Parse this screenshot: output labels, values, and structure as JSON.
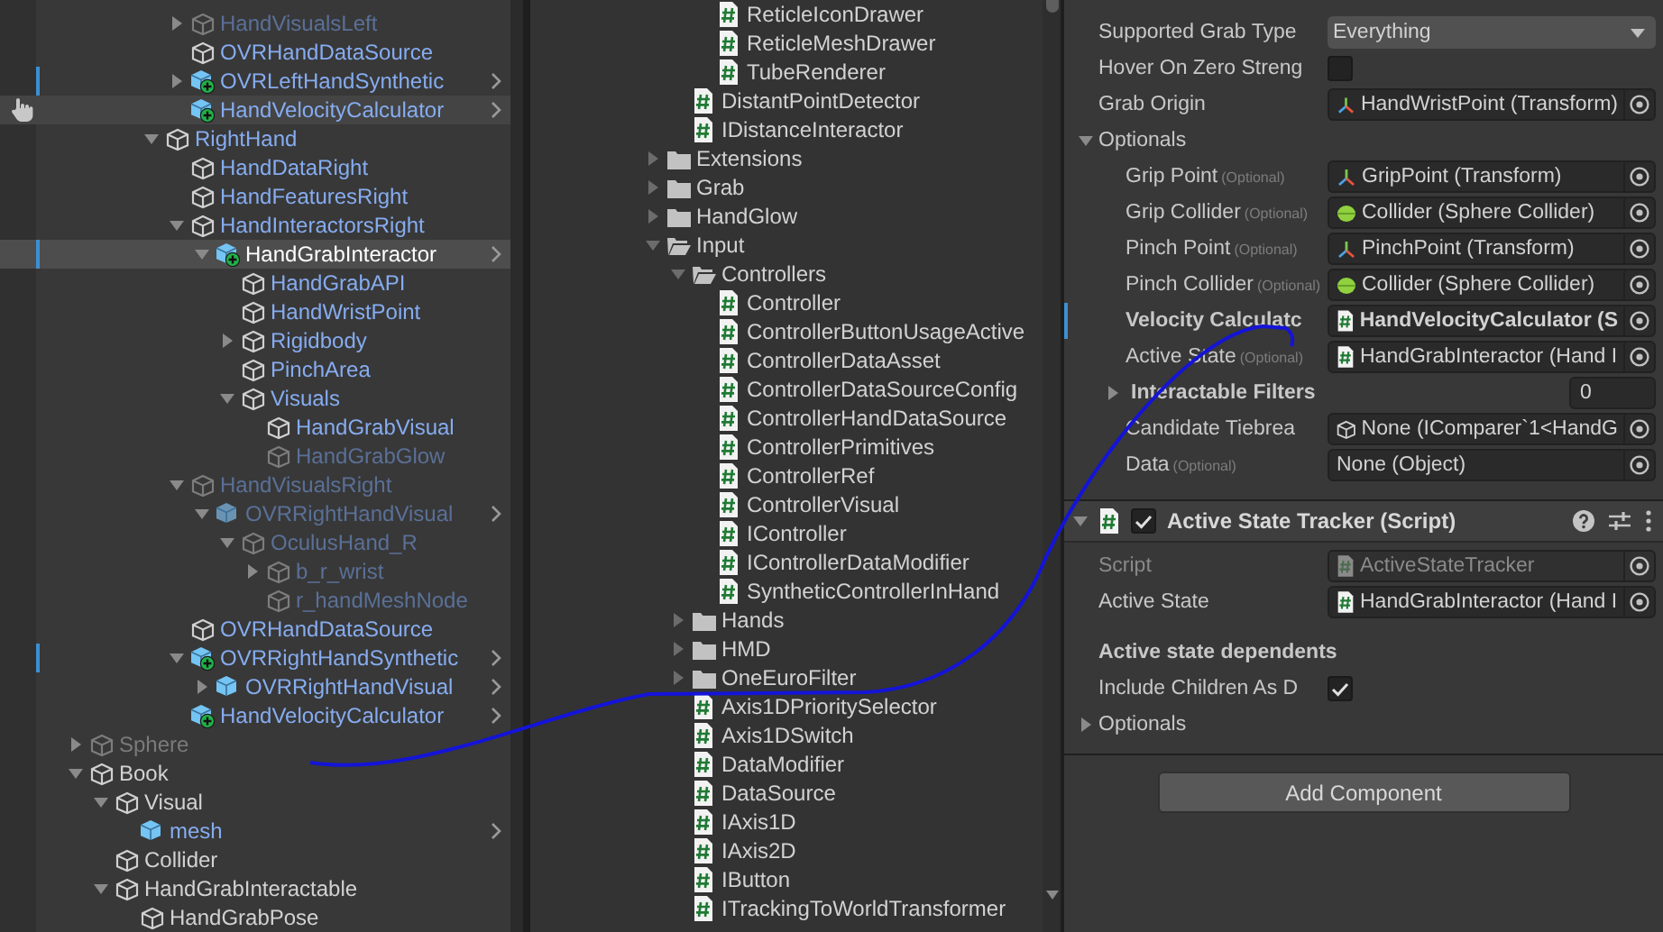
{
  "hierarchy": {
    "items": [
      {
        "children": [
          {
            "children": [
              {
                "children": [
                  {
                    "children": [
                      {
                        "label": "HandVisualsLeft",
                        "kind": "cube",
                        "prefab": true,
                        "active": false,
                        "expanded": false,
                        "selected": false
                      },
                      {
                        "label": "OVRHandDataSource",
                        "kind": "cube",
                        "prefab": true,
                        "active": true,
                        "selected": false
                      },
                      {
                        "label": "OVRLeftHandSynthetic",
                        "kind": "prefab_added",
                        "prefab": true,
                        "active": true,
                        "expanded": false,
                        "open_prefab": true,
                        "modified": true,
                        "selected": false
                      },
                      {
                        "label": "HandVelocityCalculator",
                        "kind": "prefab_added",
                        "prefab": true,
                        "active": true,
                        "open_prefab": true,
                        "hovered": true,
                        "selected": false
                      }
                    ]
                  },
                  {
                    "label": "RightHand",
                    "kind": "cube",
                    "prefab": true,
                    "active": true,
                    "expanded": true,
                    "selected": false,
                    "children": [
                      {
                        "label": "HandDataRight",
                        "kind": "cube",
                        "prefab": true,
                        "active": true,
                        "selected": false
                      },
                      {
                        "label": "HandFeaturesRight",
                        "kind": "cube",
                        "prefab": true,
                        "active": true,
                        "selected": false
                      },
                      {
                        "label": "HandInteractorsRight",
                        "kind": "cube",
                        "prefab": true,
                        "active": true,
                        "expanded": true,
                        "selected": false,
                        "children": [
                          {
                            "label": "HandGrabInteractor",
                            "kind": "prefab_added",
                            "active": true,
                            "expanded": true,
                            "open_prefab": true,
                            "modified": true,
                            "selected": true,
                            "children": [
                              {
                                "label": "HandGrabAPI",
                                "kind": "cube",
                                "prefab": true,
                                "active": true,
                                "selected": false
                              },
                              {
                                "label": "HandWristPoint",
                                "kind": "cube",
                                "prefab": true,
                                "active": true,
                                "selected": false
                              },
                              {
                                "label": "Rigidbody",
                                "kind": "cube",
                                "prefab": true,
                                "active": true,
                                "expanded": false,
                                "selected": false
                              },
                              {
                                "label": "PinchArea",
                                "kind": "cube",
                                "prefab": true,
                                "active": true,
                                "selected": false
                              },
                              {
                                "label": "Visuals",
                                "kind": "cube",
                                "prefab": true,
                                "active": true,
                                "expanded": true,
                                "selected": false,
                                "children": [
                                  {
                                    "label": "HandGrabVisual",
                                    "kind": "cube",
                                    "prefab": true,
                                    "active": true,
                                    "selected": false
                                  },
                                  {
                                    "label": "HandGrabGlow",
                                    "kind": "cube",
                                    "prefab": true,
                                    "active": false,
                                    "selected": false
                                  }
                                ]
                              }
                            ]
                          }
                        ]
                      },
                      {
                        "label": "HandVisualsRight",
                        "kind": "cube",
                        "prefab": true,
                        "active": false,
                        "expanded": true,
                        "selected": false,
                        "children": [
                          {
                            "label": "OVRRightHandVisual",
                            "kind": "prefab",
                            "prefab": true,
                            "active": false,
                            "expanded": true,
                            "open_prefab": true,
                            "selected": false,
                            "children": [
                              {
                                "label": "OculusHand_R",
                                "kind": "cube",
                                "prefab": true,
                                "active": false,
                                "expanded": true,
                                "selected": false,
                                "children": [
                                  {
                                    "label": "b_r_wrist",
                                    "kind": "cube",
                                    "prefab": true,
                                    "active": false,
                                    "expanded": false,
                                    "selected": false
                                  },
                                  {
                                    "label": "r_handMeshNode",
                                    "kind": "cube",
                                    "prefab": true,
                                    "active": false,
                                    "selected": false
                                  }
                                ]
                              }
                            ]
                          }
                        ]
                      },
                      {
                        "label": "OVRHandDataSource",
                        "kind": "cube",
                        "prefab": true,
                        "active": true,
                        "selected": false
                      },
                      {
                        "label": "OVRRightHandSynthetic",
                        "kind": "prefab_added",
                        "prefab": true,
                        "active": true,
                        "expanded": true,
                        "open_prefab": true,
                        "modified": true,
                        "selected": false,
                        "children": [
                          {
                            "label": "OVRRightHandVisual",
                            "kind": "prefab",
                            "prefab": true,
                            "active": true,
                            "expanded": false,
                            "open_prefab": true,
                            "selected": false
                          }
                        ]
                      },
                      {
                        "label": "HandVelocityCalculator",
                        "kind": "prefab_added",
                        "prefab": true,
                        "active": true,
                        "open_prefab": true,
                        "selected": false
                      }
                    ]
                  }
                ]
              }
            ]
          }
        ]
      },
      {
        "label": "Sphere",
        "kind": "cube",
        "prefab": false,
        "active": false,
        "expanded": false,
        "selected": false
      },
      {
        "label": "Book",
        "kind": "cube",
        "prefab": false,
        "active": true,
        "expanded": true,
        "selected": false,
        "children": [
          {
            "label": "Visual",
            "kind": "cube",
            "prefab": false,
            "active": true,
            "expanded": true,
            "selected": false,
            "children": [
              {
                "label": "mesh",
                "kind": "prefab",
                "prefab": true,
                "active": true,
                "open_prefab": true,
                "selected": false
              }
            ]
          },
          {
            "label": "Collider",
            "kind": "cube",
            "prefab": false,
            "active": true,
            "selected": false
          },
          {
            "label": "HandGrabInteractable",
            "kind": "cube",
            "prefab": false,
            "active": true,
            "expanded": true,
            "selected": false,
            "children": [
              {
                "label": "HandGrabPose",
                "kind": "cube",
                "prefab": false,
                "active": true,
                "selected": false
              }
            ]
          }
        ]
      }
    ]
  },
  "project": {
    "items": [
      {
        "children": [
          {
            "children": [
              {
                "label": "ReticleIconDrawer",
                "kind": "script"
              },
              {
                "label": "ReticleMeshDrawer",
                "kind": "script"
              },
              {
                "label": "TubeRenderer",
                "kind": "script"
              }
            ]
          },
          {
            "label": "DistantPointDetector",
            "kind": "script"
          },
          {
            "label": "IDistanceInteractor",
            "kind": "script"
          }
        ]
      },
      {
        "label": "Extensions",
        "kind": "folder",
        "expanded": false
      },
      {
        "label": "Grab",
        "kind": "folder",
        "expanded": false
      },
      {
        "label": "HandGlow",
        "kind": "folder",
        "expanded": false
      },
      {
        "label": "Input",
        "kind": "folder",
        "expanded": true,
        "children": [
          {
            "label": "Controllers",
            "kind": "folder",
            "expanded": true,
            "children": [
              {
                "label": "Controller",
                "kind": "script"
              },
              {
                "label": "ControllerButtonUsageActive",
                "kind": "script"
              },
              {
                "label": "ControllerDataAsset",
                "kind": "script"
              },
              {
                "label": "ControllerDataSourceConfig",
                "kind": "script"
              },
              {
                "label": "ControllerHandDataSource",
                "kind": "script"
              },
              {
                "label": "ControllerPrimitives",
                "kind": "script"
              },
              {
                "label": "ControllerRef",
                "kind": "script"
              },
              {
                "label": "ControllerVisual",
                "kind": "script"
              },
              {
                "label": "IController",
                "kind": "script"
              },
              {
                "label": "IControllerDataModifier",
                "kind": "script"
              },
              {
                "label": "SyntheticControllerInHand",
                "kind": "script"
              }
            ]
          },
          {
            "label": "Hands",
            "kind": "folder",
            "expanded": false
          },
          {
            "label": "HMD",
            "kind": "folder",
            "expanded": false
          },
          {
            "label": "OneEuroFilter",
            "kind": "folder",
            "expanded": false
          },
          {
            "label": "Axis1DPrioritySelector",
            "kind": "script"
          },
          {
            "label": "Axis1DSwitch",
            "kind": "script"
          },
          {
            "label": "DataModifier",
            "kind": "script"
          },
          {
            "label": "DataSource",
            "kind": "script"
          },
          {
            "label": "IAxis1D",
            "kind": "script"
          },
          {
            "label": "IAxis2D",
            "kind": "script"
          },
          {
            "label": "IButton",
            "kind": "script"
          },
          {
            "label": "ITrackingToWorldTransformer",
            "kind": "script"
          }
        ]
      }
    ]
  },
  "inspector": {
    "fields": [
      {
        "kind": "dropdown",
        "label": "Supported Grab Type",
        "value": "Everything"
      },
      {
        "kind": "checkbox",
        "label": "Hover On Zero Streng",
        "checked": false
      },
      {
        "kind": "transform_ref",
        "label": "Grab Origin",
        "value": "HandWristPoint (Transform)"
      },
      {
        "kind": "foldout",
        "label": "Optionals",
        "expanded": true,
        "children": [
          {
            "kind": "transform_ref",
            "label": "Grip Point",
            "tag": "(Optional)",
            "value": "GripPoint (Transform)"
          },
          {
            "kind": "collider_ref",
            "label": "Grip Collider",
            "tag": "(Optional)",
            "value": "Collider (Sphere Collider)"
          },
          {
            "kind": "transform_ref",
            "label": "Pinch Point",
            "tag": "(Optional)",
            "value": "PinchPoint (Transform)"
          },
          {
            "kind": "collider_ref",
            "label": "Pinch Collider",
            "tag": "(Optional)",
            "value": "Collider (Sphere Collider)"
          },
          {
            "kind": "script_ref",
            "label": "Velocity Calculatc",
            "value": "HandVelocityCalculator (S",
            "modified": true
          },
          {
            "kind": "script_ref",
            "label": "Active State",
            "tag": "(Optional)",
            "value": "HandGrabInteractor (Hand I"
          },
          {
            "kind": "list",
            "label": "Interactable Filters",
            "value": "0",
            "expanded": false
          },
          {
            "kind": "object_ref",
            "label": "Candidate Tiebrea",
            "value": "None (IComparer`1<HandG"
          },
          {
            "kind": "empty_ref",
            "label": "Data",
            "tag": "(Optional)",
            "value": "None (Object)"
          }
        ]
      }
    ],
    "component": {
      "title": "Active State Tracker (Script)",
      "enabled": true,
      "expanded": true,
      "fields": [
        {
          "kind": "script_ref",
          "label": "Script",
          "value": "ActiveStateTracker",
          "disabled": true
        },
        {
          "kind": "script_ref",
          "label": "Active State",
          "value": "HandGrabInteractor (Hand I"
        },
        {
          "kind": "heading",
          "label": "Active state dependents"
        },
        {
          "kind": "checkbox",
          "label": "Include Children As D",
          "checked": true
        },
        {
          "kind": "foldout",
          "label": "Optionals",
          "expanded": false
        }
      ]
    },
    "add_component": "Add Component"
  }
}
